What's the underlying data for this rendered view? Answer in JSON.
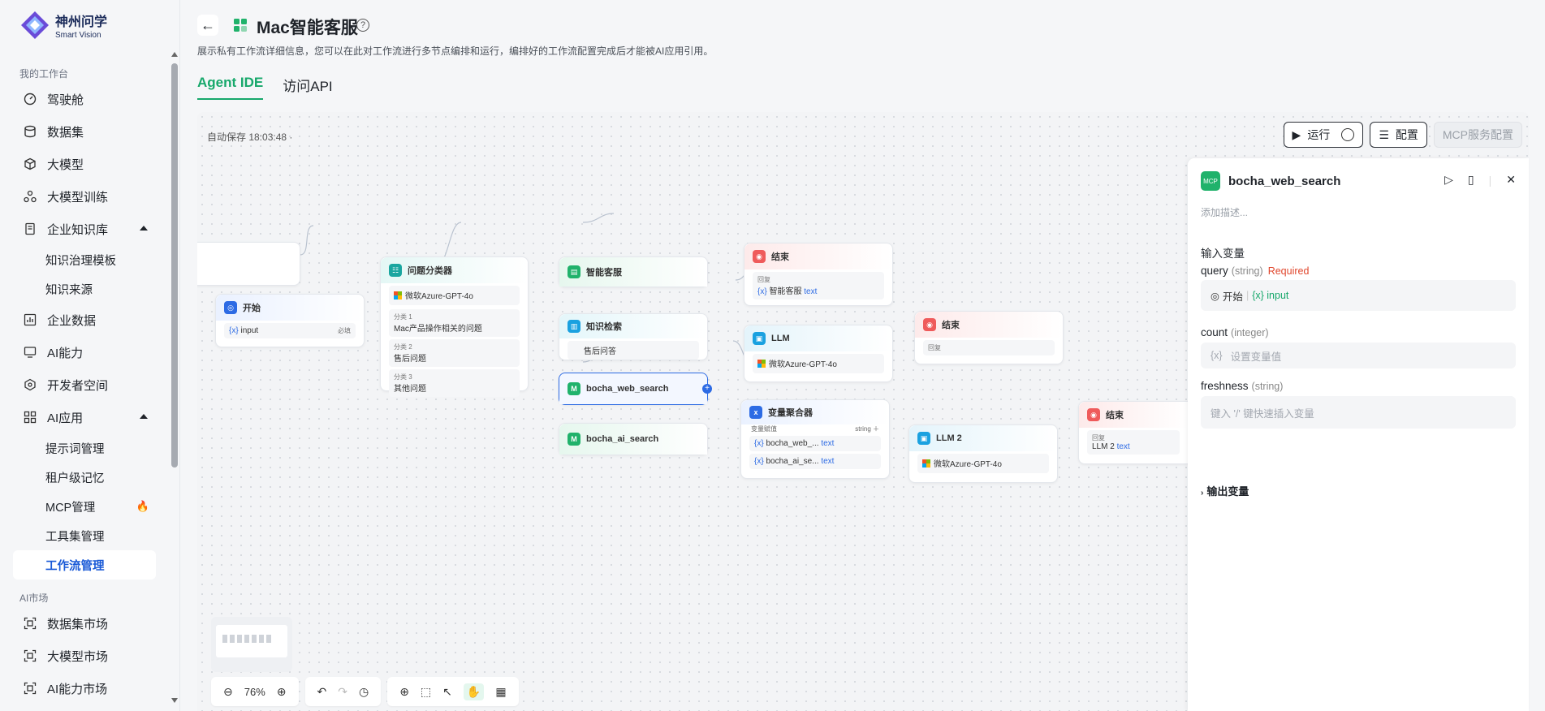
{
  "logo": {
    "name": "神州问学",
    "sub": "Smart Vision"
  },
  "sidebar": {
    "section1": "我的工作台",
    "items": [
      {
        "label": "驾驶舱",
        "icon": "dashboard-icon"
      },
      {
        "label": "数据集",
        "icon": "database-icon"
      },
      {
        "label": "大模型",
        "icon": "cube-icon"
      },
      {
        "label": "大模型训练",
        "icon": "training-icon"
      },
      {
        "label": "企业知识库",
        "icon": "knowledge-icon"
      },
      {
        "label": "企业数据",
        "icon": "chart-icon"
      },
      {
        "label": "AI能力",
        "icon": "ai-icon"
      },
      {
        "label": "开发者空间",
        "icon": "developer-icon"
      },
      {
        "label": "AI应用",
        "icon": "apps-icon"
      }
    ],
    "kb_sub": [
      "知识治理模板",
      "知识来源"
    ],
    "app_sub": [
      "提示词管理",
      "租户级记忆",
      "MCP管理",
      "工具集管理",
      "工作流管理"
    ],
    "section2": "AI市场",
    "market": [
      "数据集市场",
      "大模型市场",
      "AI能力市场"
    ]
  },
  "header": {
    "title": "Mac智能客服",
    "desc": "展示私有工作流详细信息，您可以在此对工作流进行多节点编排和运行，编排好的工作流配置完成后才能被AI应用引用。",
    "tabs": [
      "Agent IDE",
      "访问API"
    ]
  },
  "canvas": {
    "autosave": "自动保存 18:03:48 ·",
    "run": "运行",
    "config": "配置",
    "mcp": "MCP服务配置",
    "zoom": "76%"
  },
  "nodes": {
    "start": {
      "title": "开始",
      "var": "input",
      "req": "必填"
    },
    "classifier": {
      "title": "问题分类器",
      "model": "微软Azure-GPT-4o",
      "classes": [
        {
          "label": "分类 1",
          "text": "Mac产品操作相关的问题"
        },
        {
          "label": "分类 2",
          "text": "售后问题"
        },
        {
          "label": "分类 3",
          "text": "其他问题"
        }
      ]
    },
    "cs": {
      "title": "智能客服"
    },
    "kb": {
      "title": "知识检索",
      "item": "售后问答"
    },
    "web": {
      "title": "bocha_web_search"
    },
    "ai": {
      "title": "bocha_ai_search"
    },
    "end1": {
      "title": "结束",
      "label": "回复",
      "ref": "智能客服",
      "type": "text"
    },
    "llm1": {
      "title": "LLM",
      "model": "微软Azure-GPT-4o"
    },
    "end2": {
      "title": "结束",
      "label": "回复"
    },
    "agg": {
      "title": "变量聚合器",
      "label": "变量赋值",
      "type": "string",
      "rows": [
        {
          "name": "bocha_web_...",
          "type": "text"
        },
        {
          "name": "bocha_ai_se...",
          "type": "text"
        }
      ]
    },
    "llm2": {
      "title": "LLM 2",
      "model": "微软Azure-GPT-4o"
    },
    "end3": {
      "title": "结束",
      "label": "回复",
      "ref": "LLM 2",
      "type": "text"
    }
  },
  "panel": {
    "title": "bocha_web_search",
    "desc": "添加描述...",
    "inputs_label": "输入变量",
    "query": {
      "name": "query",
      "type": "(string)",
      "req": "Required",
      "src": "开始",
      "var": "input"
    },
    "count": {
      "name": "count",
      "type": "(integer)",
      "ph": "设置变量值"
    },
    "freshness": {
      "name": "freshness",
      "type": "(string)",
      "ph": "键入 '/' 键快速插入变量"
    },
    "outputs_label": "输出变量"
  }
}
